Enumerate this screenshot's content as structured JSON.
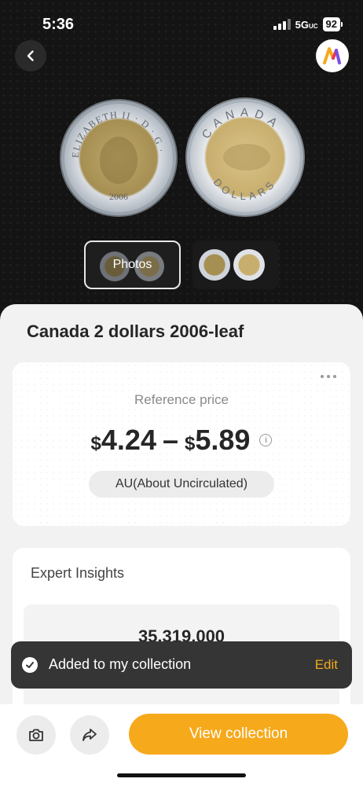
{
  "status_bar": {
    "time": "5:36",
    "network": "5G",
    "network_suffix": "UC",
    "battery": "92"
  },
  "header": {
    "back_icon": "chevron-left-icon",
    "badge_icon": "app-logo-icon"
  },
  "gallery": {
    "photos_label": "Photos"
  },
  "coin": {
    "title": "Canada 2 dollars 2006-leaf",
    "front_legend": "ELIZABETH II · D · G · REGINA",
    "front_year": "2006",
    "back_legend_top": "CANADA",
    "back_legend_bottom": "DOLLARS"
  },
  "price_card": {
    "reference_label": "Reference price",
    "currency": "$",
    "low": "4.24",
    "separator": "–",
    "high": "5.89",
    "info_icon": "info-icon",
    "grade": "AU(About Uncirculated)"
  },
  "insights": {
    "title": "Expert Insights",
    "mintage": "35,319,000"
  },
  "toast": {
    "message": "Added to my collection",
    "action": "Edit"
  },
  "bottom_bar": {
    "camera_icon": "camera-icon",
    "share_icon": "share-icon",
    "primary_label": "View collection"
  },
  "colors": {
    "accent": "#f6a91b",
    "toast_bg": "#353535",
    "sheet_bg": "#f2f2f2"
  }
}
